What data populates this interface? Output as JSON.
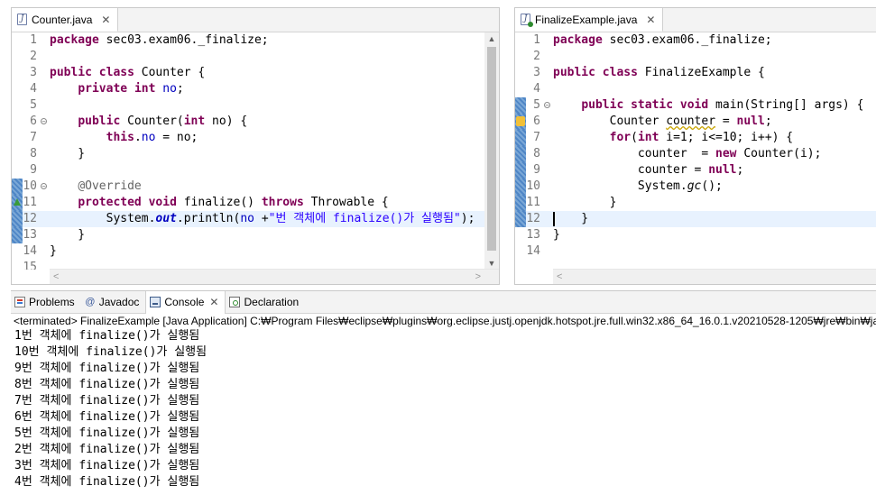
{
  "left_editor": {
    "tab_label": "Counter.java",
    "lines": [
      {
        "n": "1",
        "html": "<span class=\"kw\">package</span> sec03.exam06._finalize;"
      },
      {
        "n": "2",
        "html": ""
      },
      {
        "n": "3",
        "html": "<span class=\"kw\">public</span> <span class=\"kw\">class</span> Counter {"
      },
      {
        "n": "4",
        "html": "    <span class=\"kw\">private</span> <span class=\"kw\">int</span> <span class=\"fld\">no</span>;"
      },
      {
        "n": "5",
        "html": ""
      },
      {
        "n": "6",
        "html": "    <span class=\"kw\">public</span> Counter(<span class=\"kw\">int</span> no) {",
        "fold": true
      },
      {
        "n": "7",
        "html": "        <span class=\"kw\">this</span>.<span class=\"fld\">no</span> = no;"
      },
      {
        "n": "8",
        "html": "    }"
      },
      {
        "n": "9",
        "html": ""
      },
      {
        "n": "10",
        "html": "    <span class=\"ann\">@Override</span>",
        "fold": true,
        "mark": "blue"
      },
      {
        "n": "11",
        "html": "    <span class=\"kw\">protected</span> <span class=\"kw\">void</span> finalize() <span class=\"kw\">throws</span> Throwable {",
        "mark": "blue",
        "override": true
      },
      {
        "n": "12",
        "html": "        System.<span class=\"sfld\">out</span>.println(<span class=\"fld\">no</span> +<span class=\"str\">\"번 객체에 finalize()가 실행됨\"</span>);",
        "mark": "blue",
        "hl": true
      },
      {
        "n": "13",
        "html": "    }",
        "mark": "blue"
      },
      {
        "n": "14",
        "html": "}"
      },
      {
        "n": "15",
        "html": ""
      }
    ]
  },
  "right_editor": {
    "tab_label": "FinalizeExample.java",
    "lines": [
      {
        "n": "1",
        "html": "<span class=\"kw\">package</span> sec03.exam06._finalize;"
      },
      {
        "n": "2",
        "html": ""
      },
      {
        "n": "3",
        "html": "<span class=\"kw\">public</span> <span class=\"kw\">class</span> FinalizeExample {"
      },
      {
        "n": "4",
        "html": ""
      },
      {
        "n": "5",
        "html": "    <span class=\"kw\">public</span> <span class=\"kw\">static</span> <span class=\"kw\">void</span> main(String[] args) {",
        "fold": true,
        "mark": "blue"
      },
      {
        "n": "6",
        "html": "        Counter <span class=\"warn\">counter</span> = <span class=\"kw\">null</span>;",
        "mark": "blue",
        "warning": true
      },
      {
        "n": "7",
        "html": "        <span class=\"kw\">for</span>(<span class=\"kw\">int</span> i=1; i&lt;=10; i++) {",
        "mark": "blue"
      },
      {
        "n": "8",
        "html": "            counter  = <span class=\"kw\">new</span> Counter(i);",
        "mark": "blue"
      },
      {
        "n": "9",
        "html": "            counter = <span class=\"kw\">null</span>;",
        "mark": "blue"
      },
      {
        "n": "10",
        "html": "            System.<span class=\"smeth\">gc</span>();",
        "mark": "blue"
      },
      {
        "n": "11",
        "html": "        }",
        "mark": "blue"
      },
      {
        "n": "12",
        "html": "    }",
        "mark": "blue",
        "hl": true,
        "cursor": true
      },
      {
        "n": "13",
        "html": "}"
      },
      {
        "n": "14",
        "html": ""
      }
    ]
  },
  "bottom_panel": {
    "tabs": [
      {
        "label": "Problems",
        "icon": "problems"
      },
      {
        "label": "Javadoc",
        "icon": "javadoc"
      },
      {
        "label": "Console",
        "icon": "console",
        "active": true
      },
      {
        "label": "Declaration",
        "icon": "decl"
      }
    ],
    "status": "<terminated> FinalizeExample [Java Application] C:₩Program Files₩eclipse₩plugins₩org.eclipse.justj.openjdk.hotspot.jre.full.win32.x86_64_16.0.1.v20210528-1205₩jre₩bin₩javaw.exe",
    "output": [
      "1번 객체에 finalize()가 실행됨",
      "10번 객체에 finalize()가 실행됨",
      "9번 객체에 finalize()가 실행됨",
      "8번 객체에 finalize()가 실행됨",
      "7번 객체에 finalize()가 실행됨",
      "6번 객체에 finalize()가 실행됨",
      "5번 객체에 finalize()가 실행됨",
      "2번 객체에 finalize()가 실행됨",
      "3번 객체에 finalize()가 실행됨",
      "4번 객체에 finalize()가 실행됨"
    ]
  }
}
